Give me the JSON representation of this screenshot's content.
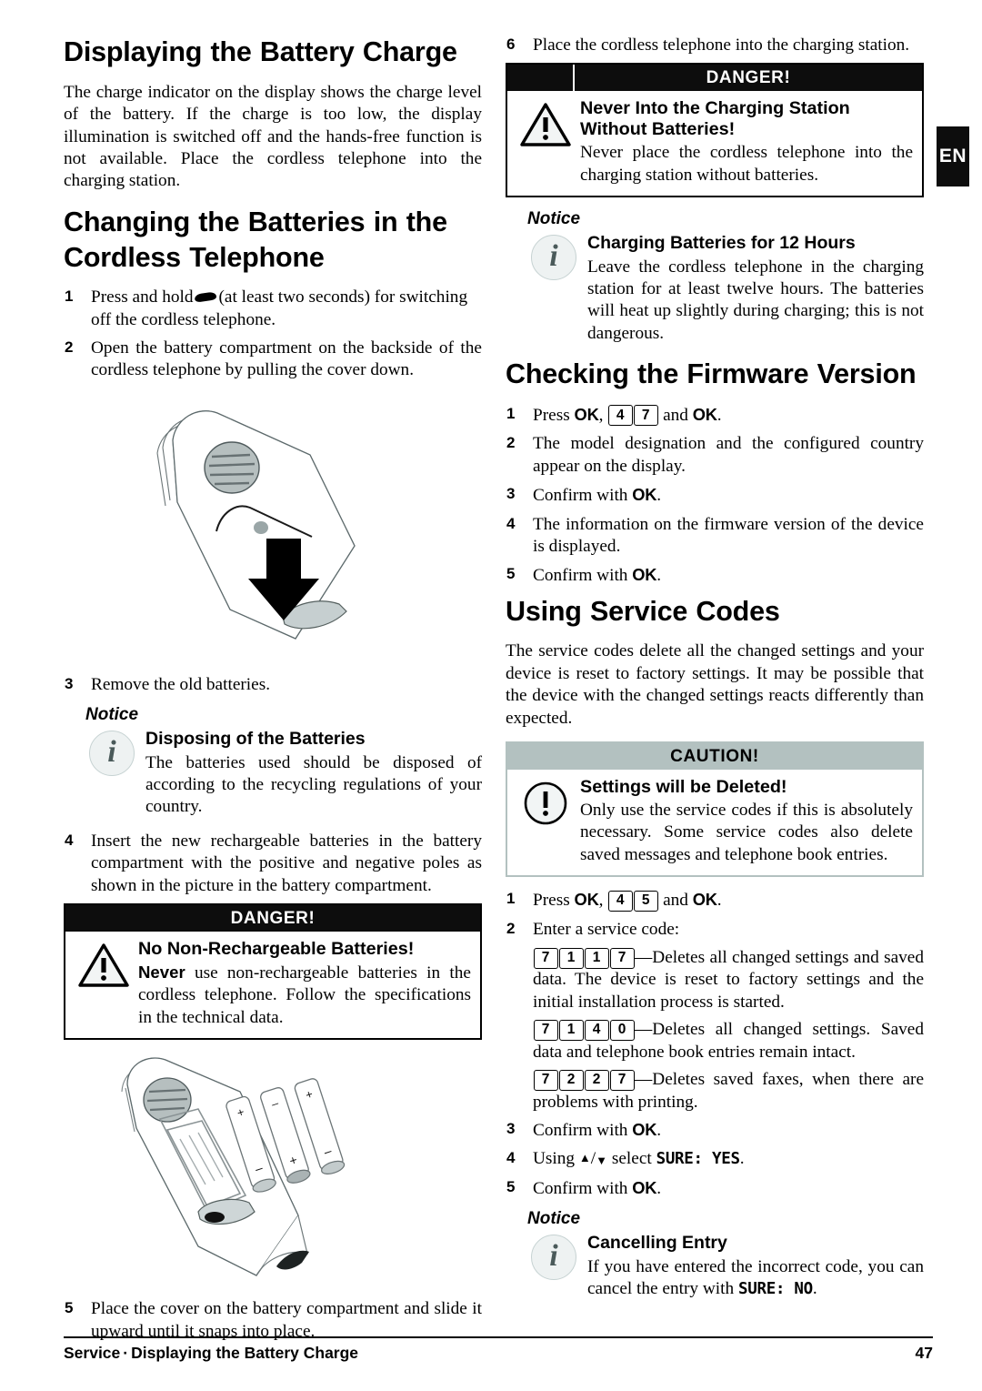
{
  "language_tab": "EN",
  "left_column": {
    "heading1": "Displaying the Battery Charge",
    "intro_paragraph": "The charge indicator on the display shows the charge level of the battery. If the charge is too low, the display illumination is switched off and the hands-free function is not available. Place the cordless telephone into the charging station.",
    "heading2": "Changing the Batteries in the Cordless Telephone",
    "step1_num": "1",
    "step1_text_a": "Press and hold",
    "step1_text_b": "(at least two seconds) for switching off the cordless telephone.",
    "step2_num": "2",
    "step2_text": "Open the battery compartment on the backside of the cordless telephone by pulling the cover down.",
    "figure1_alt": "cordless-handset-cover-pull-down",
    "step3_num": "3",
    "step3_text": "Remove the old batteries.",
    "notice1_label": "Notice",
    "notice1_title": "Disposing of the Batteries",
    "notice1_text": "The batteries used should be disposed of according to the recycling regulations of your country.",
    "step4_num": "4",
    "step4_text": "Insert the new rechargeable batteries in the battery compartment with the positive and negative poles as shown in the picture in the battery compartment.",
    "danger1_header": "DANGER!",
    "danger1_title": "No Non-Rechargeable Batteries!",
    "danger1_bold_lead": "Never",
    "danger1_text": " use non-rechargeable batteries in the cordless telephone. Follow the specifications in the technical data.",
    "figure2_alt": "battery-compartment-with-three-batteries",
    "step5_num": "5",
    "step5_text": "Place the cover on the battery compartment and slide it upward until it snaps into place."
  },
  "right_column": {
    "step6_num": "6",
    "step6_text": "Place the cordless telephone into the charging station.",
    "danger2_header": "DANGER!",
    "danger2_title": "Never Into the Charging Station Without Batteries!",
    "danger2_text": "Never place the cordless telephone into the charging station without batteries.",
    "notice2_label": "Notice",
    "notice2_title": "Charging Batteries for 12 Hours",
    "notice2_text": "Leave the cordless telephone in the charging station for at least twelve hours. The batteries will heat up slightly during charging; this is not dangerous.",
    "heading3": "Checking the Firmware Version",
    "fw_step1_num": "1",
    "fw_step1_pre": "Press",
    "fw_step1_ok1": "OK",
    "fw_step1_comma": ",",
    "fw_step1_keys": [
      "4",
      "7"
    ],
    "fw_step1_and": "and",
    "fw_step1_ok2": "OK",
    "fw_step1_period": ".",
    "fw_step2_num": "2",
    "fw_step2_text": "The model designation and the configured country appear on the display.",
    "fw_step3_num": "3",
    "fw_step3_pre": "Confirm with",
    "fw_step3_ok": "OK",
    "fw_step3_period": ".",
    "fw_step4_num": "4",
    "fw_step4_text": "The information on the firmware version of the device is displayed.",
    "fw_step5_num": "5",
    "fw_step5_pre": "Confirm with",
    "fw_step5_ok": "OK",
    "fw_step5_period": ".",
    "heading4": "Using Service Codes",
    "service_intro": "The service codes delete all the changed settings and your device is reset to factory settings. It may be possible that the device with the changed settings reacts differently than expected.",
    "caution_header": "CAUTION!",
    "caution_title": "Settings will be Deleted!",
    "caution_text": "Only use the service codes if this is absolutely necessary. Some service codes also delete saved messages and telephone book entries.",
    "sc_step1_num": "1",
    "sc_step1_pre": "Press",
    "sc_step1_ok1": "OK",
    "sc_step1_comma": ",",
    "sc_step1_keys": [
      "4",
      "5"
    ],
    "sc_step1_and": "and",
    "sc_step1_ok2": "OK",
    "sc_step1_period": ".",
    "sc_step2_num": "2",
    "sc_step2_text": "Enter a service code:",
    "codes": [
      {
        "keys": [
          "7",
          "1",
          "1",
          "7"
        ],
        "description": "—Deletes all changed settings and saved data. The device is reset to factory settings and the initial installation process is started."
      },
      {
        "keys": [
          "7",
          "1",
          "4",
          "0"
        ],
        "description": "—Deletes all changed settings. Saved data and telephone book entries remain intact."
      },
      {
        "keys": [
          "7",
          "2",
          "2",
          "7"
        ],
        "description": "—Deletes saved faxes, when there are problems with printing."
      }
    ],
    "sc_step3_num": "3",
    "sc_step3_pre": "Confirm with",
    "sc_step3_ok": "OK",
    "sc_step3_period": ".",
    "sc_step4_num": "4",
    "sc_step4_pre": "Using",
    "sc_step4_mid": "select",
    "sc_step4_lcd": "SURE: YES",
    "sc_step4_period": ".",
    "sc_step5_num": "5",
    "sc_step5_pre": "Confirm with",
    "sc_step5_ok": "OK",
    "sc_step5_period": ".",
    "notice3_label": "Notice",
    "notice3_title": "Cancelling Entry",
    "notice3_text_a": "If you have entered the incorrect code, you can cancel the entry with",
    "notice3_lcd": "SURE: NO",
    "notice3_period": "."
  },
  "footer": {
    "section": "Service",
    "separator": "·",
    "title": "Displaying the Battery Charge",
    "page_number": "47"
  }
}
